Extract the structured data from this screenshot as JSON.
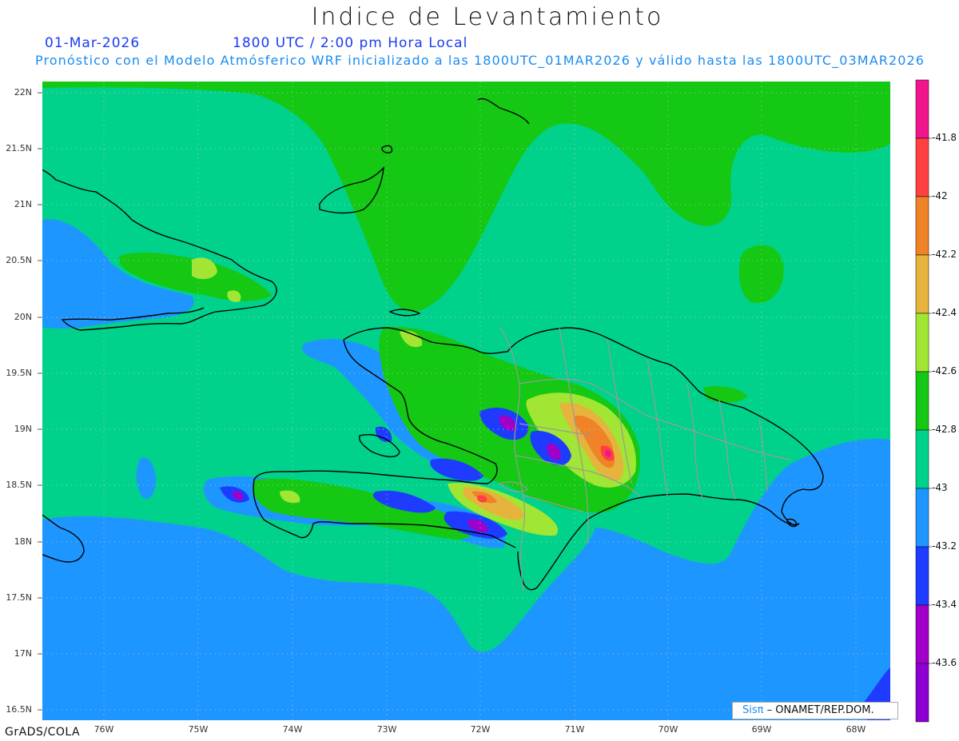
{
  "title": "Indice de Levantamiento",
  "date": "01-Mar-2026",
  "time": "1800 UTC / 2:00 pm Hora Local",
  "forecast": "Pronóstico con el Modelo Atmósferico WRF inicializado a las 1800UTC_01MAR2026 y válido hasta las  1800UTC_03MAR2026",
  "lat_labels": [
    "22N",
    "21.5N",
    "21N",
    "20.5N",
    "20N",
    "19.5N",
    "19N",
    "18.5N",
    "18N",
    "17.5N",
    "17N",
    "16.5N"
  ],
  "lon_labels": [
    "76W",
    "75W",
    "74W",
    "73W",
    "72W",
    "71W",
    "70W",
    "69W",
    "68W"
  ],
  "colorbar": {
    "labels": [
      "-41.8",
      "-42",
      "-42.2",
      "-42.4",
      "-42.6",
      "-42.8",
      "-43",
      "-43.2",
      "-43.4",
      "-43.6"
    ],
    "colors": [
      "#f0158c",
      "#ff4040",
      "#f08228",
      "#e6b43c",
      "#a0e632",
      "#14c814",
      "#00d28c",
      "#1e96ff",
      "#1e3cff",
      "#a000c8",
      "#8c00d2"
    ]
  },
  "footer": {
    "software": "GrADS/COLA",
    "credit_brand": "Sisπ",
    "credit_text": "– ONAMET/REP.DOM."
  },
  "colors": {
    "green": "#14c814",
    "teal": "#00d28c",
    "blue": "#1e96ff",
    "navy": "#1e3cff",
    "purple": "#a000c8",
    "light_green": "#a0e632",
    "yellow": "#e6b43c",
    "orange": "#f08228",
    "red": "#ff4040",
    "magenta": "#f0158c"
  }
}
